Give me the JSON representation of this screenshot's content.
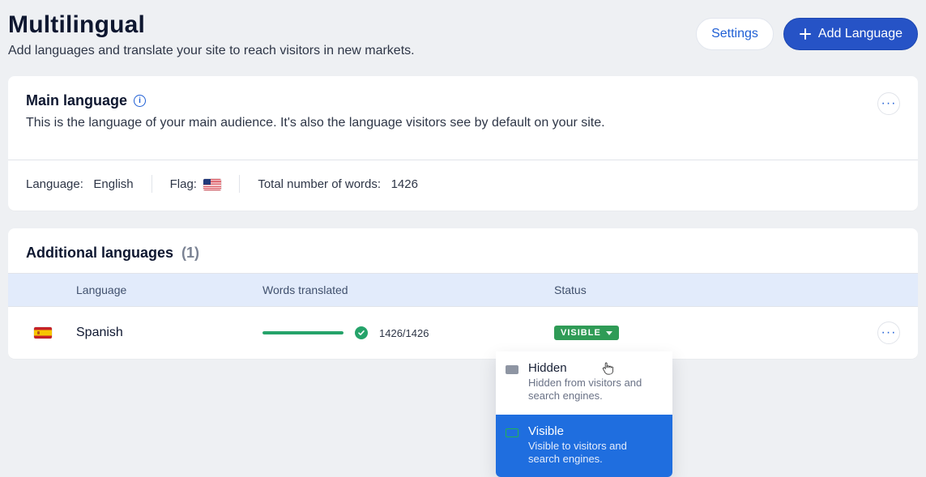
{
  "header": {
    "title": "Multilingual",
    "subtitle": "Add languages and translate your site to reach visitors in new markets.",
    "settings_label": "Settings",
    "add_language_label": "Add Language"
  },
  "main_language": {
    "card_title": "Main language",
    "card_desc": "This is the language of your main audience. It's also the language visitors see by default on your site.",
    "language_label": "Language:",
    "language_value": "English",
    "flag_label": "Flag:",
    "total_words_label": "Total number of words:",
    "total_words_value": "1426"
  },
  "additional": {
    "card_title": "Additional languages",
    "count_text": "(1)",
    "columns": {
      "language": "Language",
      "words_translated": "Words translated",
      "status": "Status"
    },
    "row": {
      "language_name": "Spanish",
      "words_count_text": "1426/1426",
      "status_badge": "VISIBLE"
    }
  },
  "status_menu": {
    "hidden_title": "Hidden",
    "hidden_desc": "Hidden from visitors and search engines.",
    "visible_title": "Visible",
    "visible_desc": "Visible to visitors and search engines."
  }
}
